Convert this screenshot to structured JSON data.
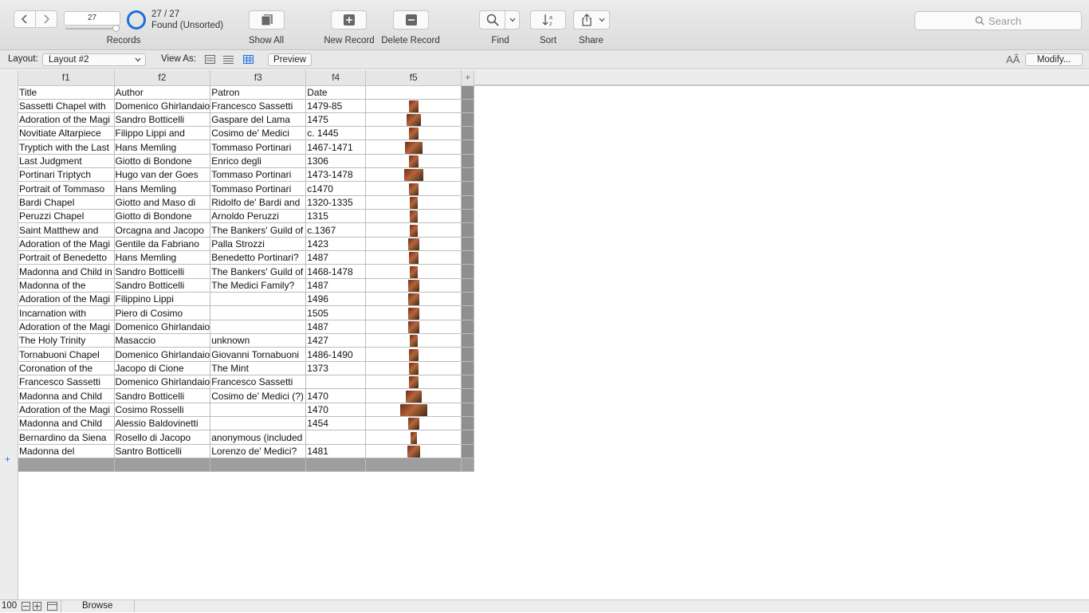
{
  "toolbar": {
    "record_number": "27",
    "found_count": "27 / 27",
    "found_status": "Found (Unsorted)",
    "records_label": "Records",
    "show_all_label": "Show All",
    "new_record_label": "New Record",
    "delete_record_label": "Delete Record",
    "find_label": "Find",
    "sort_label": "Sort",
    "share_label": "Share",
    "search_placeholder": "Search",
    "accent_color": "#1e6fd9"
  },
  "layout_bar": {
    "layout_label": "Layout:",
    "layout_value": "Layout #2",
    "view_as_label": "View As:",
    "preview_label": "Preview",
    "modify_label": "Modify...",
    "font_icon_glyph": "AÂ"
  },
  "table": {
    "columns": [
      "f1",
      "f2",
      "f3",
      "f4",
      "f5"
    ],
    "add_column_glyph": "+",
    "rows": [
      [
        "Title",
        "Author",
        "Patron",
        "Date",
        ""
      ],
      [
        "Sassetti Chapel with",
        "Domenico Ghirlandaio",
        "Francesco Sassetti",
        "1479-85",
        "img"
      ],
      [
        "Adoration of the Magi",
        "Sandro Botticelli",
        "Gaspare del Lama",
        "1475",
        "img"
      ],
      [
        "Novitiate Altarpiece",
        "Filippo Lippi and",
        "Cosimo de' Medici",
        "c. 1445",
        "img"
      ],
      [
        "Tryptich with the Last",
        "Hans Memling",
        "Tommaso Portinari",
        "1467-1471",
        "img"
      ],
      [
        "Last Judgment",
        "Giotto di Bondone",
        "Enrico degli",
        "1306",
        "img"
      ],
      [
        "Portinari Triptych",
        "Hugo van der Goes",
        "Tommaso Portinari",
        "1473-1478",
        "img"
      ],
      [
        "Portrait of Tommaso",
        "Hans Memling",
        "Tommaso Portinari",
        "c1470",
        "img"
      ],
      [
        "Bardi Chapel",
        " Giotto and Maso di",
        "Ridolfo de' Bardi and",
        "1320-1335",
        "img"
      ],
      [
        "Peruzzi Chapel",
        "Giotto di Bondone",
        "Arnoldo Peruzzi",
        "1315",
        "img"
      ],
      [
        "Saint Matthew and",
        "Orcagna and Jacopo",
        "The Bankers' Guild of",
        "c.1367",
        "img"
      ],
      [
        "Adoration of the Magi",
        "Gentile da Fabriano",
        "Palla Strozzi",
        "1423",
        "img"
      ],
      [
        "Portrait of Benedetto",
        "Hans Memling",
        "Benedetto Portinari?",
        "1487",
        "img"
      ],
      [
        "Madonna and Child in",
        "Sandro Botticelli",
        "The Bankers' Guild of",
        "1468-1478",
        "img"
      ],
      [
        "Madonna of the",
        "Sandro Botticelli",
        "The Medici Family?",
        "1487",
        "img"
      ],
      [
        "Adoration of the Magi",
        "Filippino Lippi",
        "",
        "1496",
        "img"
      ],
      [
        "Incarnation with",
        "Piero di Cosimo",
        "",
        "1505",
        "img"
      ],
      [
        "Adoration of the Magi",
        "Domenico Ghirlandaio",
        "",
        "1487",
        "img"
      ],
      [
        "The Holy Trinity",
        "Masaccio",
        "unknown",
        "1427",
        "img"
      ],
      [
        "Tornabuoni Chapel",
        "Domenico Ghirlandaio",
        "Giovanni Tornabuoni",
        "1486-1490",
        "img"
      ],
      [
        "Coronation of the",
        "Jacopo di Cione",
        "The Mint",
        "1373",
        "img"
      ],
      [
        "Francesco Sassetti",
        "Domenico Ghirlandaio",
        "Francesco Sassetti",
        "",
        "img"
      ],
      [
        "Madonna and Child",
        "Sandro Botticelli",
        "Cosimo de' Medici (?)",
        "1470",
        "img"
      ],
      [
        "Adoration of the Magi",
        "Cosimo Rosselli",
        "",
        "1470",
        "img"
      ],
      [
        "Madonna and Child",
        "Alessio Baldovinetti",
        "",
        "1454",
        "img"
      ],
      [
        "Bernardino da Siena",
        "Rosello di Jacopo",
        "anonymous (included",
        "",
        "img"
      ],
      [
        "Madonna del",
        "Santro Botticelli",
        "Lorenzo de' Medici?",
        "1481",
        "img"
      ]
    ],
    "thumb_widths": [
      0,
      12,
      18,
      12,
      22,
      12,
      24,
      12,
      10,
      10,
      10,
      14,
      12,
      10,
      14,
      14,
      14,
      14,
      10,
      12,
      12,
      12,
      20,
      34,
      14,
      8,
      16
    ]
  },
  "statusbar": {
    "zoom": "100",
    "mode": "Browse"
  }
}
